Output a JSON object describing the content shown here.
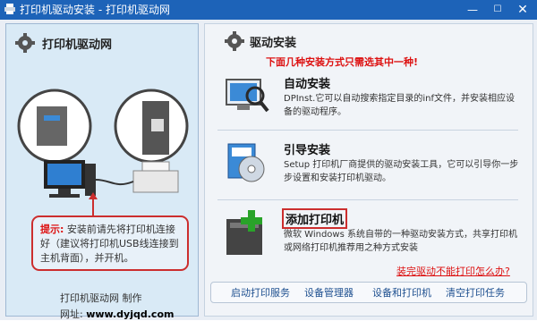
{
  "window": {
    "title": "打印机驱动安装 - 打印机驱动网",
    "min": "—",
    "max": "☐",
    "close": "✕"
  },
  "left": {
    "title": "打印机驱动网",
    "hint_label": "提示:",
    "hint_text": "安装前请先将打印机连接好（建议将打印机USB线连接到主机背面），并开机。",
    "credit": "打印机驱动网  制作",
    "url_label": "网址:",
    "url": "www.dyjqd.com"
  },
  "right": {
    "title": "驱动安装",
    "warning": "下面几种安装方式只需选其中一种!",
    "options": [
      {
        "title": "自动安装",
        "desc": "DPInst.它可以自动搜索指定目录的inf文件，并安装相应设备的驱动程序。",
        "icon": "magnifier-monitor-icon"
      },
      {
        "title": "引导安装",
        "desc": "Setup 打印机厂商提供的驱动安装工具，它可以引导你一步步设置和安装打印机驱动。",
        "icon": "setup-cd-icon"
      },
      {
        "title": "添加打印机",
        "desc": "微软 Windows 系统自带的一种驱动安装方式，共享打印机或网络打印机推荐用之种方式安装",
        "icon": "add-printer-icon"
      }
    ],
    "help_link": "装完驱动不能打印怎么办?",
    "bottom_links": [
      "启动打印服务",
      "设备管理器",
      "设备和打印机",
      "清空打印任务"
    ]
  },
  "colors": {
    "titlebar": "#1d63b8",
    "warning": "#d11111",
    "highlight_border": "#cc2e2e"
  }
}
